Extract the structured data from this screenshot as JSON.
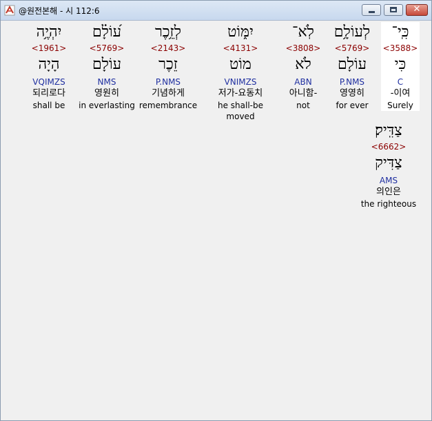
{
  "window": {
    "title": "@원전본해 - 시 112:6"
  },
  "words": [
    {
      "heb": "כִּֽי־",
      "strong": "<3588>",
      "lemma": "כִּי",
      "morph": "C",
      "kor": "-이여",
      "eng": "Surely"
    },
    {
      "heb": "לְעוֹלָ֥ם",
      "strong": "<5769>",
      "lemma": "עוֹלָם",
      "morph": "P.NMS",
      "kor": "영영히",
      "eng": "for ever"
    },
    {
      "heb": "לֹֽא־",
      "strong": "<3808>",
      "lemma": "לֹא",
      "morph": "ABN",
      "kor": "아니함-",
      "eng": "not"
    },
    {
      "heb": "יִמּ֑וֹט",
      "strong": "<4131>",
      "lemma": "מוֹט",
      "morph": "VNIMZS",
      "kor": "저가-요동치",
      "eng": "he shall-be moved"
    },
    {
      "heb": "לְזֵ֥כֶר",
      "strong": "<2143>",
      "lemma": "זֵכֶר",
      "morph": "P.NMS",
      "kor": "기념하게",
      "eng": "remembrance"
    },
    {
      "heb": "ע֝וֹלָ֗ם",
      "strong": "<5769>",
      "lemma": "עוֹלָם",
      "morph": "NMS",
      "kor": "영원히",
      "eng": "in everlasting"
    },
    {
      "heb": "יִהְיֶ֥ה",
      "strong": "<1961>",
      "lemma": "הָיָה",
      "morph": "VQIMZS",
      "kor": "되리로다",
      "eng": "shall be"
    },
    {
      "heb": "צַדִּֽיק׃",
      "strong": "<6662>",
      "lemma": "צַדִּיק",
      "morph": "AMS",
      "kor": "의인은",
      "eng": "the righteous"
    }
  ]
}
